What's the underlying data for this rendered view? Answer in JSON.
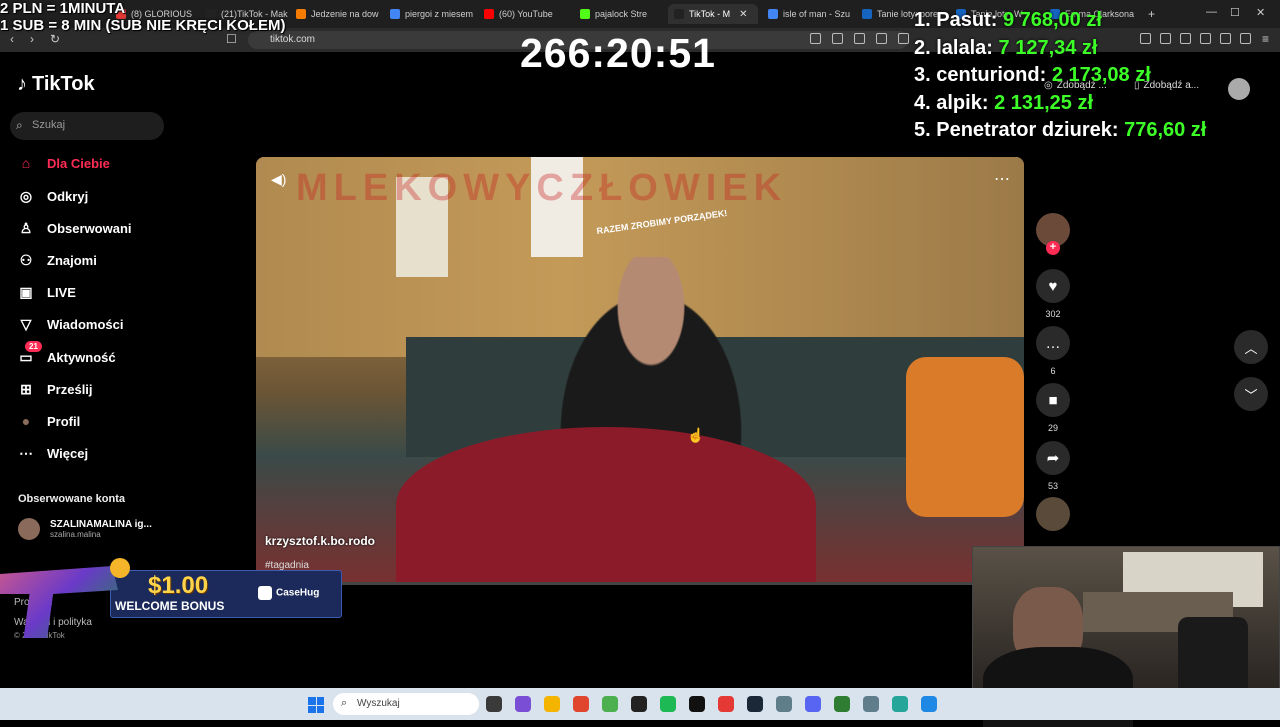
{
  "overlay": {
    "promo_line1": "2 PLN = 1MINUTA",
    "promo_line2": "1 SUB = 8 MIN (SUB NIE KRĘCI KOŁEM)",
    "timer": "266:20:51",
    "leaderboard": [
      {
        "rank": "1.",
        "name": "Pasut:",
        "amount": "9 768,00 zł"
      },
      {
        "rank": "2.",
        "name": "lalala:",
        "amount": "7 127,34 zł"
      },
      {
        "rank": "3.",
        "name": "centuriond:",
        "amount": "2 173,08 zł"
      },
      {
        "rank": "4.",
        "name": "alpik:",
        "amount": "2 131,25 zł"
      },
      {
        "rank": "5.",
        "name": "Penetrator dziurek:",
        "amount": "776,60 zł"
      }
    ]
  },
  "browser": {
    "tabs": [
      {
        "label": "(8) GLORIOUS",
        "color": "#e53935"
      },
      {
        "label": "(21)TikTok - Mak",
        "color": "#222222"
      },
      {
        "label": "Jedzenie na dow",
        "color": "#f57c00"
      },
      {
        "label": "piergoi z miesem",
        "color": "#4285f4"
      },
      {
        "label": "(60) YouTube",
        "color": "#ff0000"
      },
      {
        "label": "pajalock Stre",
        "color": "#53fc18"
      },
      {
        "label": "TikTok - M",
        "color": "#222222",
        "active": true
      },
      {
        "label": "isle of man - Szu",
        "color": "#4285f4"
      },
      {
        "label": "Tanie loty: pore",
        "color": "#1565c0"
      },
      {
        "label": "Tanie loty: W",
        "color": "#1565c0"
      },
      {
        "label": "Emma Clarksona",
        "color": "#1565c0"
      }
    ],
    "tab_close": "✕",
    "new_tab": "+",
    "url": "tiktok.com"
  },
  "tiktok": {
    "logo_text": "TikTok",
    "search_placeholder": "Szukaj",
    "nav": [
      {
        "label": "Dla Ciebie",
        "icon": "home-icon",
        "glyph": "⌂",
        "active": true
      },
      {
        "label": "Odkryj",
        "icon": "compass-icon",
        "glyph": "◎"
      },
      {
        "label": "Obserwowani",
        "icon": "person-follow-icon",
        "glyph": "♙"
      },
      {
        "label": "Znajomi",
        "icon": "friends-icon",
        "glyph": "⚇"
      },
      {
        "label": "LIVE",
        "icon": "live-icon",
        "glyph": "▣"
      },
      {
        "label": "Wiadomości",
        "icon": "send-icon",
        "glyph": "▽"
      },
      {
        "label": "Aktywność",
        "icon": "activity-icon",
        "glyph": "▭",
        "badge": "21"
      },
      {
        "label": "Prześlij",
        "icon": "upload-icon",
        "glyph": "⊞"
      },
      {
        "label": "Profil",
        "icon": "profile-avatar",
        "glyph": "●"
      },
      {
        "label": "Więcej",
        "icon": "more-icon",
        "glyph": "⋯"
      }
    ],
    "followed_title": "Obserwowane konta",
    "followed_account": {
      "name": "SZALINAMALINA ig...",
      "handle": "szalina.malina"
    },
    "footer_links": [
      "Program",
      "Warunki i polityka"
    ],
    "copyright": "© 2026 TikTok",
    "header_buttons": [
      "Zdobądź ...",
      "Zdobądź a..."
    ],
    "video": {
      "author": "krzysztof.k.bo.rodo",
      "tag": "#tagadnia",
      "watermark": "MLEKOWYCZŁOWIEK",
      "banner": "RAZEM ZROBIMY PORZĄDEK!",
      "progress": 0.0
    },
    "actions": [
      {
        "name": "like",
        "glyph": "♥",
        "count": "302"
      },
      {
        "name": "comment",
        "glyph": "…",
        "count": "6"
      },
      {
        "name": "bookmark",
        "glyph": "■",
        "count": "29"
      },
      {
        "name": "share",
        "glyph": "➦",
        "count": "53"
      }
    ],
    "nav_up": "︿",
    "nav_down": "﹀"
  },
  "ad": {
    "amount": "$1.00",
    "subtitle": "WELCOME BONUS",
    "brand": "CaseHug"
  },
  "taskbar": {
    "search_placeholder": "Wyszukaj",
    "apps": [
      "#3a3a3a",
      "#7a4fd6",
      "#f5b400",
      "#e0452e",
      "#4caf50",
      "#222222",
      "#1db954",
      "#111111",
      "#e53935",
      "#1b2838",
      "#607d8b",
      "#5865f2",
      "#2e7d32",
      "#607d8b",
      "#26a69a",
      "#1e88e5"
    ]
  }
}
